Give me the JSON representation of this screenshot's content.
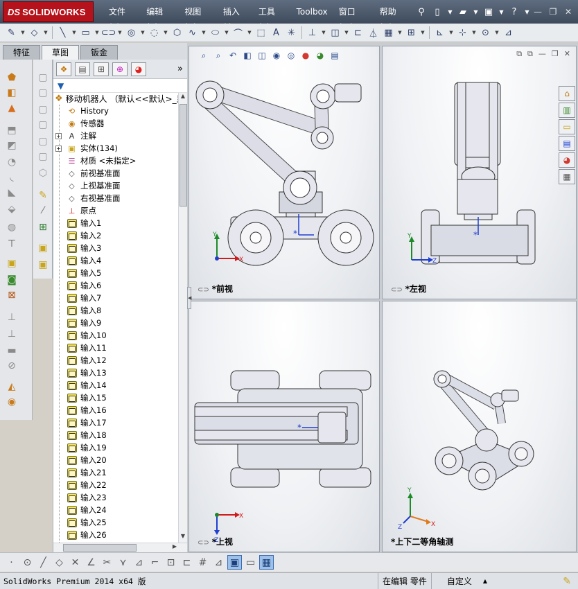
{
  "app": {
    "logo_ds": "DS",
    "logo_name": "SOLIDWORKS",
    "menu": [
      "文件(F)",
      "编辑(E)",
      "视图(V)",
      "插入(I)",
      "工具(T)",
      "Toolbox",
      "窗口(W)",
      "帮助(H)"
    ]
  },
  "tabs": [
    {
      "label": "特征",
      "active": false
    },
    {
      "label": "草图",
      "active": true
    },
    {
      "label": "钣金",
      "active": false
    }
  ],
  "tree": {
    "root_label": "移动机器人 （默认<<默认>_显",
    "nodes": [
      {
        "label": "History",
        "icon": "history-icon",
        "expander": ""
      },
      {
        "label": "传感器",
        "icon": "sensor-icon",
        "expander": ""
      },
      {
        "label": "注解",
        "icon": "annotation-icon",
        "expander": "+"
      },
      {
        "label": "实体(134)",
        "icon": "solid-bodies-icon",
        "expander": "+"
      },
      {
        "label": "材质 <未指定>",
        "icon": "material-icon",
        "expander": ""
      },
      {
        "label": "前视基准面",
        "icon": "plane-icon",
        "expander": ""
      },
      {
        "label": "上视基准面",
        "icon": "plane-icon",
        "expander": ""
      },
      {
        "label": "右视基准面",
        "icon": "plane-icon",
        "expander": ""
      },
      {
        "label": "原点",
        "icon": "origin-icon",
        "expander": ""
      },
      {
        "label": "输入1",
        "icon": "imported-part-icon",
        "expander": ""
      },
      {
        "label": "输入2",
        "icon": "imported-part-icon",
        "expander": ""
      },
      {
        "label": "输入3",
        "icon": "imported-part-icon",
        "expander": ""
      },
      {
        "label": "输入4",
        "icon": "imported-part-icon",
        "expander": ""
      },
      {
        "label": "输入5",
        "icon": "imported-part-icon",
        "expander": ""
      },
      {
        "label": "输入6",
        "icon": "imported-part-icon",
        "expander": ""
      },
      {
        "label": "输入7",
        "icon": "imported-part-icon",
        "expander": ""
      },
      {
        "label": "输入8",
        "icon": "imported-part-icon",
        "expander": ""
      },
      {
        "label": "输入9",
        "icon": "imported-part-icon",
        "expander": ""
      },
      {
        "label": "输入10",
        "icon": "imported-part-icon",
        "expander": ""
      },
      {
        "label": "输入11",
        "icon": "imported-part-icon",
        "expander": ""
      },
      {
        "label": "输入12",
        "icon": "imported-part-icon",
        "expander": ""
      },
      {
        "label": "输入13",
        "icon": "imported-part-icon",
        "expander": ""
      },
      {
        "label": "输入14",
        "icon": "imported-part-icon",
        "expander": ""
      },
      {
        "label": "输入15",
        "icon": "imported-part-icon",
        "expander": ""
      },
      {
        "label": "输入16",
        "icon": "imported-part-icon",
        "expander": ""
      },
      {
        "label": "输入17",
        "icon": "imported-part-icon",
        "expander": ""
      },
      {
        "label": "输入18",
        "icon": "imported-part-icon",
        "expander": ""
      },
      {
        "label": "输入19",
        "icon": "imported-part-icon",
        "expander": ""
      },
      {
        "label": "输入20",
        "icon": "imported-part-icon",
        "expander": ""
      },
      {
        "label": "输入21",
        "icon": "imported-part-icon",
        "expander": ""
      },
      {
        "label": "输入22",
        "icon": "imported-part-icon",
        "expander": ""
      },
      {
        "label": "输入23",
        "icon": "imported-part-icon",
        "expander": ""
      },
      {
        "label": "输入24",
        "icon": "imported-part-icon",
        "expander": ""
      },
      {
        "label": "输入25",
        "icon": "imported-part-icon",
        "expander": ""
      },
      {
        "label": "输入26",
        "icon": "imported-part-icon",
        "expander": ""
      }
    ]
  },
  "viewports": {
    "front": {
      "label": "*前视"
    },
    "left": {
      "label": "*左视"
    },
    "top": {
      "label": "*上视"
    },
    "iso": {
      "label": "*上下二等角轴测"
    }
  },
  "axes": {
    "x": "X",
    "y": "Y",
    "z": "Z"
  },
  "status": {
    "app_version": "SolidWorks Premium 2014 x64 版",
    "mode": "在编辑 零件",
    "units": "自定义",
    "units_arrow": "▲"
  },
  "colors": {
    "titlebar": "#4b5669",
    "logo_red": "#b6121b",
    "axis_x": "#d11a1a",
    "axis_y": "#1d8a2a",
    "axis_z": "#1f3fd1",
    "selected_blue": "#9ec1ea"
  }
}
